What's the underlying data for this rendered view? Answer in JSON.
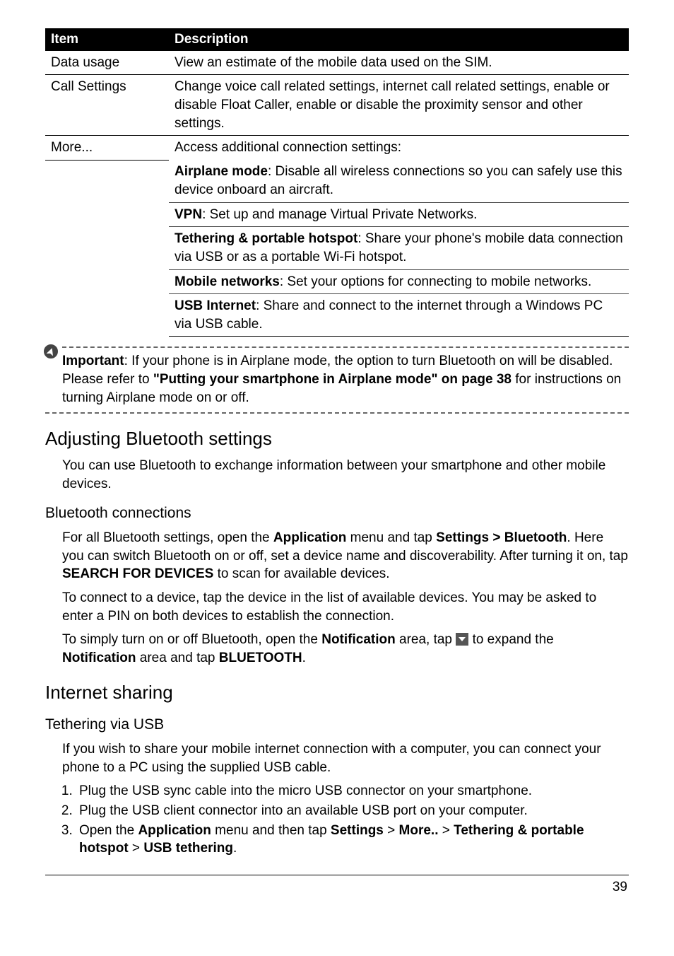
{
  "table": {
    "headers": {
      "item": "Item",
      "desc": "Description"
    },
    "row1": {
      "item": "Data usage",
      "desc": "View an estimate of the mobile data used on the SIM."
    },
    "row2": {
      "item": "Call Settings",
      "desc": "Change voice call related settings, internet call related settings, enable or disable Float Caller, enable or disable the proximity sensor and other settings."
    },
    "row3": {
      "item": "More...",
      "desc": "Access additional connection settings:"
    },
    "more": {
      "airplane_label": "Airplane mode",
      "airplane_rest": ": Disable all wireless connections so you can safely use this device onboard an aircraft.",
      "vpn_label": "VPN",
      "vpn_rest": ": Set up and manage Virtual Private Networks.",
      "tether_label": "Tethering & portable hotspot",
      "tether_rest": ": Share your phone's mobile data connection via USB or as a portable Wi-Fi hotspot.",
      "mobile_label": "Mobile networks",
      "mobile_rest": ": Set your options for connecting to mobile networks.",
      "usb_label": "USB Internet",
      "usb_rest": ": Share and connect to the internet through a Windows PC via USB cable."
    }
  },
  "callout": {
    "important_label": "Important",
    "text1": ": If your phone is in Airplane mode, the option to turn Bluetooth on will be disabled. Please refer to ",
    "bold_ref": "\"Putting your smartphone in Airplane mode\" on page 38",
    "text2": " for instructions on turning Airplane mode on or off."
  },
  "bluetooth": {
    "heading": "Adjusting Bluetooth settings",
    "intro": "You can use Bluetooth to exchange information between your smartphone and other mobile devices.",
    "subheading": "Bluetooth connections",
    "p1_pre": "For all Bluetooth settings, open the ",
    "p1_b1": "Application",
    "p1_mid1": " menu and tap ",
    "p1_b2": "Settings > Bluetooth",
    "p1_mid2": ". Here you can switch Bluetooth on or off, set a device name and discoverability. After turning it on, tap ",
    "p1_b3": "SEARCH FOR DEVICES",
    "p1_end": " to scan for available devices.",
    "p2": "To connect to a device, tap the device in the list of available devices. You may be asked to enter a PIN on both devices to establish the connection.",
    "p3_pre": "To simply turn on or off Bluetooth, open the ",
    "p3_b1": "Notification",
    "p3_mid1": " area, tap ",
    "p3_mid2": " to expand the ",
    "p3_b2": "Notification",
    "p3_mid3": " area and tap ",
    "p3_b3": "BLUETOOTH",
    "p3_end": "."
  },
  "internet": {
    "heading": "Internet sharing",
    "subheading": "Tethering via USB",
    "intro": "If you wish to share your mobile internet connection with a computer, you can connect your phone to a PC using the supplied USB cable.",
    "step1": "Plug the USB sync cable into the micro USB connector on your smartphone.",
    "step2": "Plug the USB client connector into an available USB port on your computer.",
    "s3_pre": "Open the ",
    "s3_b1": "Application",
    "s3_m1": " menu and then tap ",
    "s3_b2": "Settings",
    "s3_gt": " > ",
    "s3_b3": "More..",
    "s3_b4": "Tethering & portable hotspot",
    "s3_b5": "USB tethering",
    "s3_end": "."
  },
  "page_number": "39"
}
